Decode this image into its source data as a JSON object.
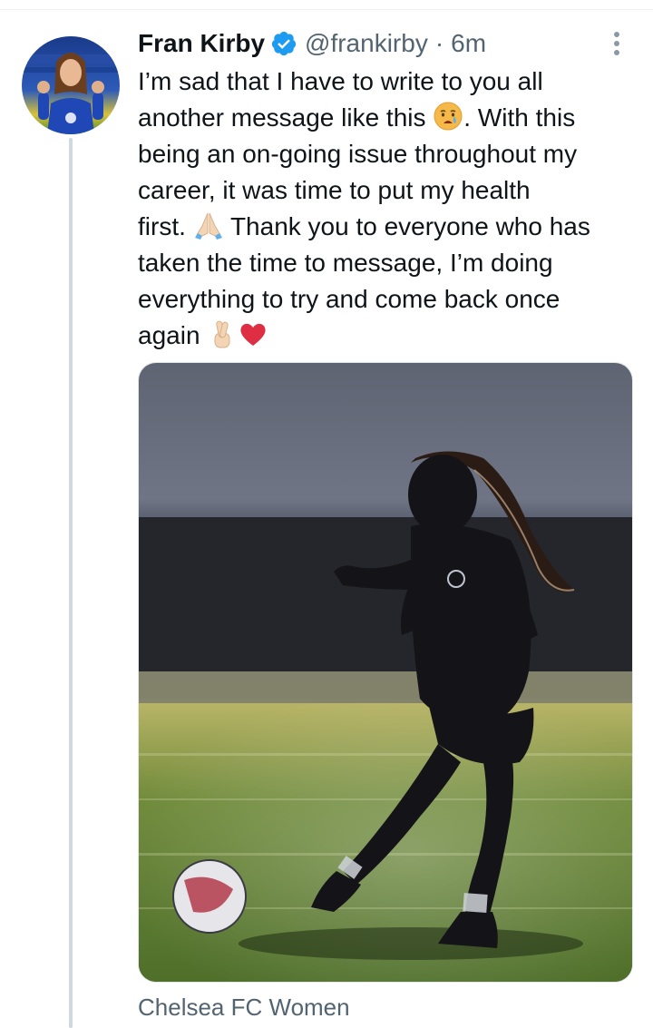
{
  "tweet": {
    "author": {
      "display_name": "Fran Kirby",
      "handle": "@frankirby",
      "verified": true,
      "avatar_icon": "avatar-photo"
    },
    "separator": "·",
    "timestamp": "6m",
    "text_lines": [
      "I’m sad that I have to write to you all",
      "another message like this",
      ". With this",
      "being an on-going issue throughout my",
      "career, it was time to put my health",
      "first.",
      "Thank you to everyone who has",
      "taken the time to message, I’m doing",
      "everything to try and come back once",
      "again"
    ],
    "emojis": {
      "line2": "crying-face",
      "line5": "folded-hands",
      "line8": [
        "crossed-fingers",
        "red-heart"
      ]
    },
    "media": {
      "type": "photo",
      "icon": "photo-footballer-kicking-ball"
    },
    "media_caption": "Chelsea FC Women",
    "more_icon": "more-vertical-icon"
  },
  "colors": {
    "text_primary": "#0f1419",
    "text_secondary": "#536471",
    "verified_blue": "#1d9bf0",
    "thread_line": "#cfd9de"
  }
}
